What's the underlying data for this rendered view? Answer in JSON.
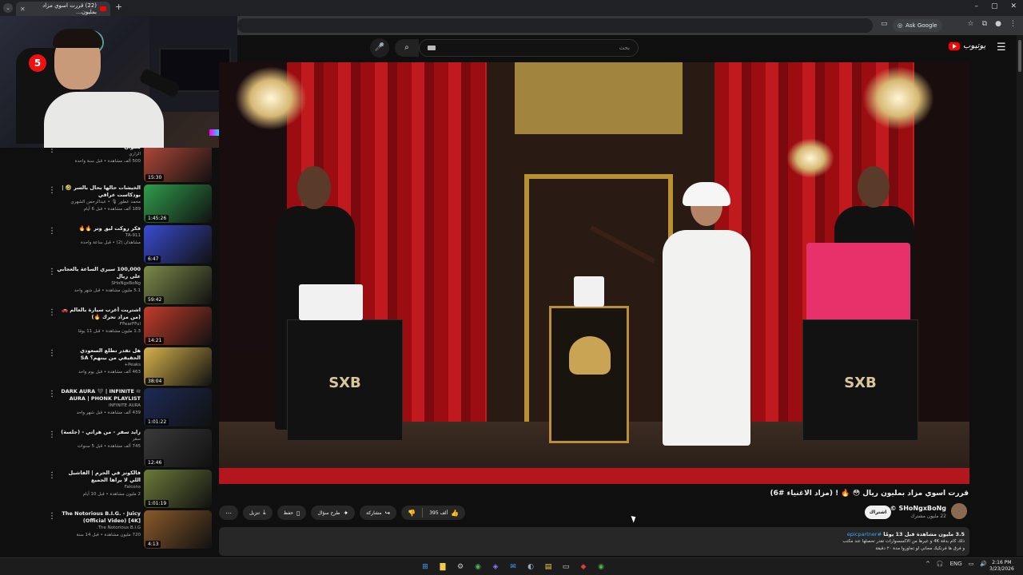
{
  "browser": {
    "tab_title": "(22) قررت اسوي مزاد بمليون...",
    "ask_google": "Ask Google"
  },
  "masthead": {
    "search_placeholder": "بحث",
    "logo_text": "بحث"
  },
  "sidebar": {
    "items": [
      {
        "title": "بعنوان",
        "channel": "الزاري",
        "meta": "500 ألف مشاهدة • قبل سنة واحدة",
        "duration": "15:30",
        "thumb": "#b4493a"
      },
      {
        "title": "الخيشات حالها بحال بالسر 🤣 | بودكاست عراقي",
        "channel": "محمد عطور 🎙 • عبدالرحمن الشهري",
        "meta": "189 ألف مشاهدة • قبل 6 أيام",
        "duration": "1:45:26",
        "thumb": "#2f9d4c"
      },
      {
        "title": "فكر روكت ليق ونر 🔥🔥",
        "channel": "TA-911",
        "meta": "مشاهدان (2) • قبل ساعة واحدة",
        "duration": "6:47",
        "thumb": "#3a4bd0"
      },
      {
        "title": "100,000 سيري الساعة بالعجابي على ريال",
        "channel": "SHoNgxBoNg",
        "meta": "5.1 مليون مشاهدة • قبل شهر واحد",
        "duration": "59:42",
        "thumb": "#7c8a4a"
      },
      {
        "title": "اشتريت أغرب سيارة بالعالم 🚗 (من مزاد تحرك 🔥)",
        "channel": "FFearFFul",
        "meta": "1.3 مليون مشاهدة • قبل 11 يومًا",
        "duration": "14:21",
        "thumb": "#c23d2b"
      },
      {
        "title": "هل تقدر تطلع السعودي الحقيقي من بينهم؟ SA",
        "channel": "Peaks+",
        "meta": "463 ألف مشاهدة • قبل يوم واحد",
        "duration": "38:04",
        "thumb": "#d6b24c"
      },
      {
        "title": "DARK AURA 🖤 | INFINITE ♾ AURA | PHONK PLAYLIST FOR...",
        "channel": "INFINITE AURA",
        "meta": "439 ألف مشاهدة • قبل شهر واحد",
        "duration": "1:01:22",
        "thumb": "#1d2a55"
      },
      {
        "title": "زايد سقر - من هراتي - (جلسة)",
        "channel": "سقر",
        "meta": "745 ألف مشاهدة • قبل 5 سنوات",
        "duration": "12:46",
        "thumb": "#3a3a3a"
      },
      {
        "title": "فالكونز في الحرم | الفاشيل اللي لا يراها الجميع",
        "channel": "Falcons",
        "meta": "2 مليون مشاهدة • قبل 10 أيام",
        "duration": "1:01:19",
        "thumb": "#6b7a3a"
      },
      {
        "title": "The Notorious B.I.G. - Juicy (Official Video) [4K]",
        "channel": "The Notorious B.I.G.",
        "meta": "720 مليون مشاهدة • قبل 14 سنة",
        "duration": "4:13",
        "thumb": "#8a5a2a"
      }
    ]
  },
  "video": {
    "podium_brand": "SXB",
    "title": "قررت اسوي مزاد بمليون ريال 😳 🔥 ! (مزاد الاغنياء #6)",
    "channel_name": "SHoNgxBoNg ©",
    "subscribers": "22 مليون مشترك",
    "subscribe_label": "اشتراك",
    "like_count": "395 ألف",
    "share_label": "مشاركة",
    "ask_label": "طرح سؤال",
    "save_label": "حفظ",
    "download_label": "تنزيل",
    "desc_stats": "3.5 مليون مشاهدة  قبل 13 يومًا",
    "desc_tag": "#epicpartner",
    "desc_line1": "ذلك كام بدقة 4K و عيرها من الاكسسوارات تقدر تحصلها عند مكتب",
    "desc_line2": "و فرق ها فرنكيك مجاني لو تجاوزوا مدة ٢٠ دقيقة"
  },
  "taskbar": {
    "lang": "ENG",
    "time": "2:16 PM",
    "date": "3/23/2026"
  }
}
